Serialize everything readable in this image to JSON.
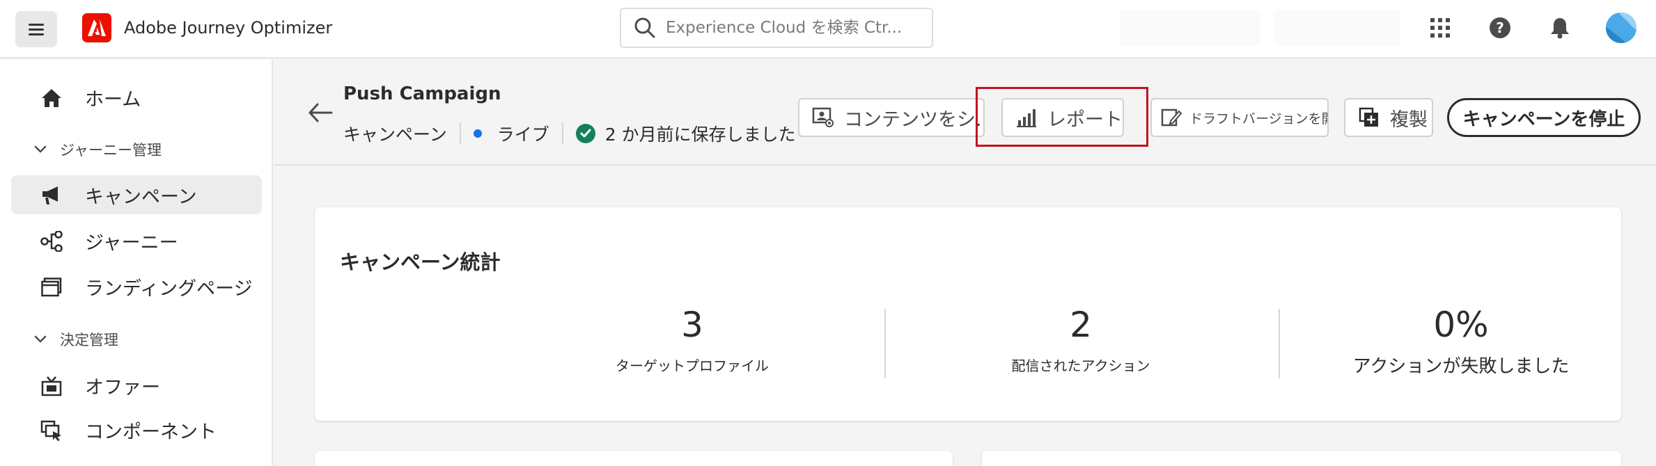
{
  "app": {
    "title": "Adobe Journey Optimizer"
  },
  "search": {
    "placeholder": "Experience Cloud を検索 Ctr..."
  },
  "topbar": {
    "icons": [
      "apps-grid-icon",
      "help-icon",
      "bell-icon",
      "avatar"
    ]
  },
  "sidebar": {
    "home": "ホーム",
    "section_journey": "ジャーニー管理",
    "campaigns": "キャンペーン",
    "journeys": "ジャーニー",
    "landing_pages": "ランディングページ",
    "section_decision": "決定管理",
    "offers": "オファー",
    "components": "コンポーネント"
  },
  "header": {
    "campaign_name": "Push Campaign",
    "type": "キャンペーン",
    "status": "ライブ",
    "saved": "2 か月前に保存しました"
  },
  "toolbar": {
    "content": "コンテンツをシ...",
    "report": "レポート",
    "open_draft": "ドラフトバージョンを開く",
    "duplicate": "複製",
    "stop": "キャンペーンを停止"
  },
  "stats": {
    "title": "キャンペーン統計",
    "items": [
      {
        "value": "3",
        "label": "ターゲットプロファイル"
      },
      {
        "value": "2",
        "label": "配信されたアクション"
      },
      {
        "value": "0%",
        "label": "アクションが失敗しました"
      }
    ]
  },
  "colors": {
    "accent": "#eb1000",
    "live": "#1473e6",
    "success": "#12805c",
    "highlight": "#c1121f"
  }
}
